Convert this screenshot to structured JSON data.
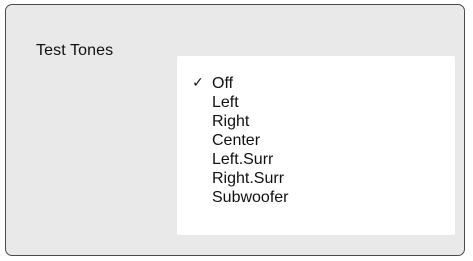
{
  "dialog": {
    "title": "Test Tones"
  },
  "menu": {
    "check_mark": "✓",
    "items": [
      {
        "label": "Off",
        "selected": true
      },
      {
        "label": "Left",
        "selected": false
      },
      {
        "label": "Right",
        "selected": false
      },
      {
        "label": "Center",
        "selected": false
      },
      {
        "label": "Left.Surr",
        "selected": false
      },
      {
        "label": "Right.Surr",
        "selected": false
      },
      {
        "label": "Subwoofer",
        "selected": false
      }
    ]
  }
}
